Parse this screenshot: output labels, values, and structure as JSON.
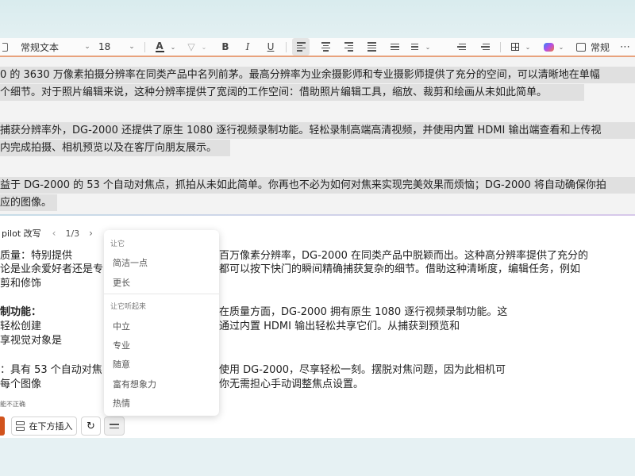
{
  "toolbar": {
    "style_name": "常规文本",
    "font_size": "18",
    "bold": "B",
    "italic": "I",
    "underline": "U",
    "styles_label": "常规"
  },
  "document": {
    "lines": [
      "0 的 3630 万像素拍摄分辨率在同类产品中名列前茅。最高分辨率为业余摄影师和专业摄影师提供了充分的空间，可以清晰地在单幅",
      "个细节。对于照片编辑来说，这种分辨率提供了宽阔的工作空间：借助照片编辑工具，缩放、裁剪和绘画从未如此简单。",
      "捕获分辨率外，DG-2000 还提供了原生 1080 逐行视频录制功能。轻松录制高端高清视频，并使用内置 HDMI 输出端查看和上传视",
      "内完成拍摄、相机预览以及在客厅向朋友展示。",
      "益于 DG-2000 的 53 个自动对焦点，抓拍从未如此简单。你再也不必为如何对焦来实现完美效果而烦恼；DG-2000 将自动确保你拍",
      "应的图像。"
    ]
  },
  "copilot": {
    "title": "pilot 改写",
    "pager": "1/3",
    "left_lines": [
      "质量：特别提供",
      "论是业余爱好者还是专",
      "剪和修饰",
      "制功能：",
      "轻松创建",
      "享视觉对象是",
      "：具有 53 个自动对焦",
      "每个图像"
    ],
    "right_lines": [
      "百万像素分辨率，DG-2000 在同类产品中脱颖而出。这种高分辨率提供了充分的",
      "都可以按下快门的瞬间精确捕获复杂的细节。借助这种清晰度，编辑任务，例如",
      "在质量方面，DG-2000 拥有原生 1080 逐行视频录制功能。这",
      "通过内置 HDMI 输出轻松共享它们。从捕获到预览和",
      "使用 DG-2000，尽享轻松一刻。摆脱对焦问题，因为此相机可",
      "你无需担心手动调整焦点设置。"
    ],
    "disclaimer": "能不正确",
    "insert_below_label": "在下方插入"
  },
  "menu": {
    "section1_header": "让它",
    "section1_items": [
      "简洁一点",
      "更长"
    ],
    "section2_header": "让它听起来",
    "section2_items": [
      "中立",
      "专业",
      "随意",
      "富有想象力",
      "热情"
    ]
  }
}
